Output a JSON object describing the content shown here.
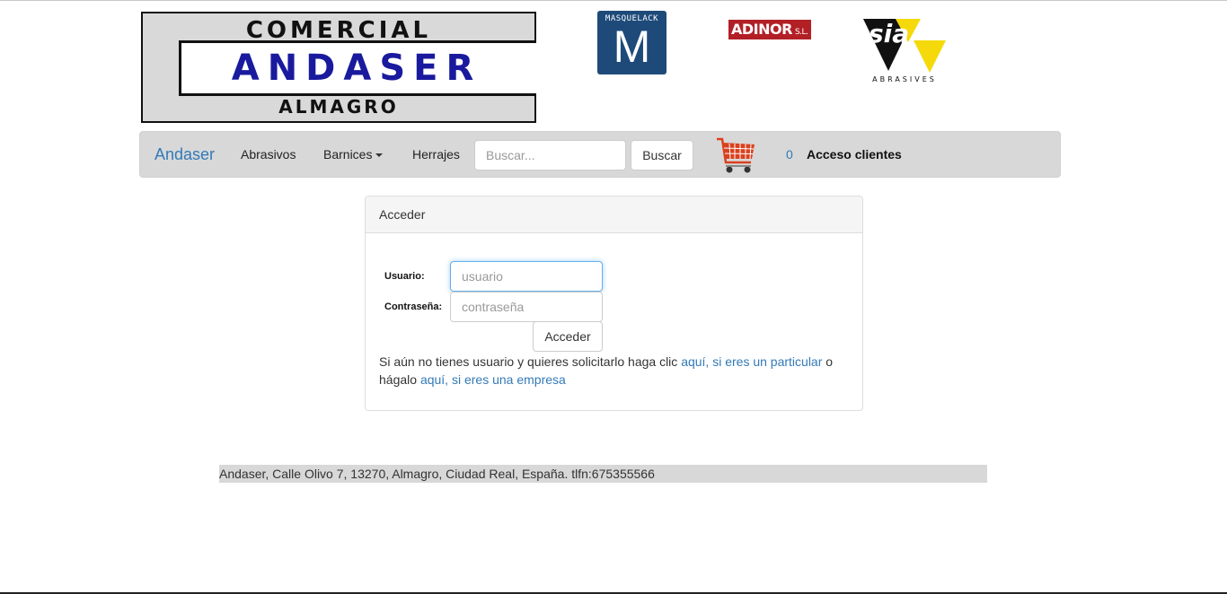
{
  "logos": {
    "main": {
      "line1": "COMERCIAL",
      "line2": "ANDASER",
      "line3": "ALMAGRO"
    },
    "masquelack": {
      "top": "MASQUELACK",
      "letter": "M"
    },
    "adinor": {
      "name": "ADINOR",
      "suffix": "S.L."
    },
    "sia": {
      "word": "sia",
      "sub": "ABRASIVES"
    }
  },
  "nav": {
    "brand": "Andaser",
    "items": [
      "Abrasivos",
      "Barnices",
      "Herrajes"
    ],
    "search_placeholder": "Buscar...",
    "search_button": "Buscar",
    "cart_count": "0",
    "client_access": "Acceso clientes",
    "cart_icon": "shopping-cart-icon"
  },
  "login": {
    "heading": "Acceder",
    "user_label": "Usuario:",
    "user_placeholder": "usuario",
    "password_label": "Contraseña:",
    "password_placeholder": "contraseña",
    "submit": "Acceder",
    "info_text_1": "Si aún no tienes usuario y quieres solicitarlo haga clic ",
    "link_particular": "aquí, si eres un particular",
    "info_text_2": " o hágalo ",
    "link_empresa": "aquí, si eres una empresa"
  },
  "footer": {
    "text": "Andaser, Calle Olivo 7, 13270, Almagro, Ciudad Real, España. tlfn:675355566"
  },
  "colors": {
    "link": "#337ab7",
    "navbar_bg": "#d8d8d8",
    "brand_blue": "#1a1a9e",
    "masquelack_blue": "#1e4a7a",
    "adinor_red": "#b22026",
    "sia_yellow": "#f5d90a",
    "cart_red": "#d9411e"
  }
}
